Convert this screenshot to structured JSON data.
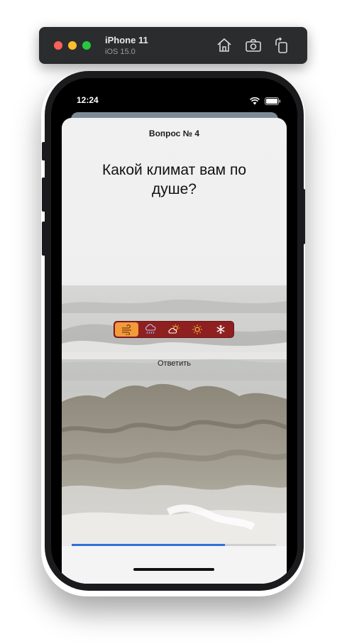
{
  "simulator": {
    "device_name": "iPhone 11",
    "os_version": "iOS 15.0",
    "buttons": [
      "home-icon",
      "screenshot-icon",
      "rotate-icon"
    ]
  },
  "status_bar": {
    "time": "12:24"
  },
  "quiz": {
    "question_number": "Вопрос № 4",
    "question_text": "Какой климат вам по душе?",
    "options": [
      {
        "icon": "wind-icon",
        "selected": true
      },
      {
        "icon": "rain-cloud-icon",
        "selected": false
      },
      {
        "icon": "partly-sunny-icon",
        "selected": false
      },
      {
        "icon": "sun-icon",
        "selected": false
      },
      {
        "icon": "snowflake-icon",
        "selected": false
      }
    ],
    "answer_button": "Ответить",
    "progress": 0.75
  },
  "colors": {
    "segment_background": "#8f2020",
    "segment_selected": "#f39a3a",
    "progress": "#2f6fdc"
  }
}
